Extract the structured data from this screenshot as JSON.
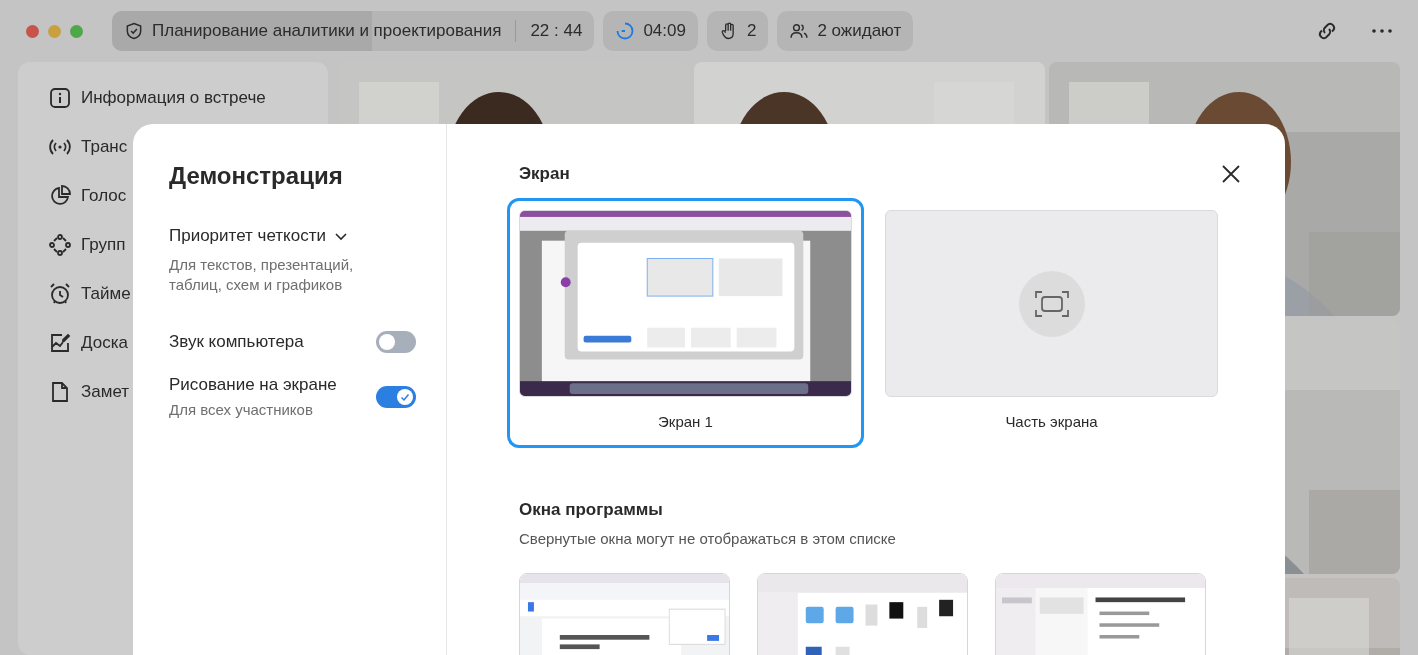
{
  "titlebar": {
    "meeting": {
      "title": "Планирование аналитики и проектирования",
      "time": "22 : 44",
      "level": 0.54
    },
    "timer": "04:09",
    "hands": "2",
    "waiting": "2 ожидают"
  },
  "sidebar": {
    "items": [
      {
        "label": "Информация о встрече"
      },
      {
        "label": "Транс"
      },
      {
        "label": "Голос"
      },
      {
        "label": "Групп"
      },
      {
        "label": "Тайме"
      },
      {
        "label": "Доска"
      },
      {
        "label": "Замет"
      }
    ]
  },
  "dialog": {
    "title": "Демонстрация",
    "quality": {
      "label": "Приоритет четкости",
      "description": "Для текстов, презентаций, таблиц, схем и графиков"
    },
    "options": [
      {
        "label": "Звук компьютера",
        "on": false
      },
      {
        "label": "Рисование на экране",
        "on": true,
        "hint": "Для всех участников"
      }
    ],
    "screen_section": {
      "title": "Экран",
      "screens": [
        {
          "kind": "screenshot",
          "label": "Экран 1",
          "selected": true
        },
        {
          "kind": "region",
          "label": "Часть экрана",
          "selected": false
        }
      ]
    },
    "windows_section": {
      "title": "Окна программы",
      "subtitle": "Свернутые окна могут не отображаться в этом списке",
      "windows": [
        {
          "kind": "document"
        },
        {
          "kind": "folder"
        },
        {
          "kind": "notes"
        }
      ]
    }
  }
}
